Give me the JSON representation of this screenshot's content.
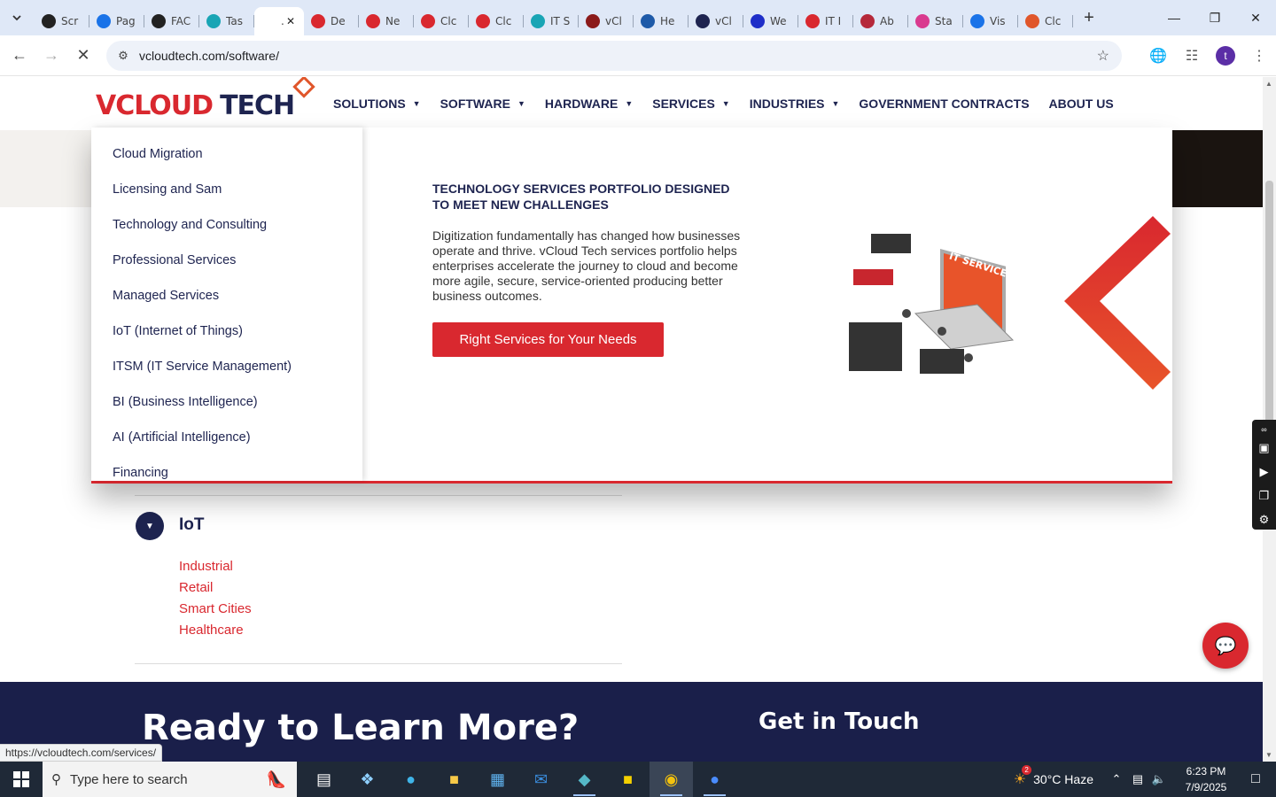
{
  "browser": {
    "tabs": [
      {
        "title": "Scr",
        "color": "#222222"
      },
      {
        "title": "Pag",
        "color": "#1a73e8"
      },
      {
        "title": "FAC",
        "color": "#222222"
      },
      {
        "title": "Tas",
        "color": "#19a5b5"
      },
      {
        "title": ".",
        "color": "#ffffff",
        "active": true
      },
      {
        "title": "De",
        "color": "#d9282f"
      },
      {
        "title": "Ne",
        "color": "#d9282f"
      },
      {
        "title": "Clc",
        "color": "#d9282f"
      },
      {
        "title": "Clc",
        "color": "#d9282f"
      },
      {
        "title": "IT S",
        "color": "#19a5b5"
      },
      {
        "title": "vCl",
        "color": "#8b1a1a"
      },
      {
        "title": "He",
        "color": "#1e5aa8"
      },
      {
        "title": "vCl",
        "color": "#1e2450"
      },
      {
        "title": "We",
        "color": "#1e2ec8"
      },
      {
        "title": "IT I",
        "color": "#d9282f"
      },
      {
        "title": "Ab",
        "color": "#b5283a"
      },
      {
        "title": "Sta",
        "color": "#d93a8f"
      },
      {
        "title": "Vis",
        "color": "#1a73e8"
      },
      {
        "title": "Clc",
        "color": "#e0562b"
      }
    ],
    "url": "vcloudtech.com/software/",
    "profile_initial": "t",
    "status_url": "https://vcloudtech.com/services/"
  },
  "site": {
    "logo": {
      "v": "V",
      "cloud": "CLOUD",
      "tech": "TECH"
    },
    "nav": [
      {
        "label": "SOLUTIONS",
        "caret": true
      },
      {
        "label": "SOFTWARE",
        "caret": true
      },
      {
        "label": "HARDWARE",
        "caret": true
      },
      {
        "label": "SERVICES",
        "caret": true
      },
      {
        "label": "INDUSTRIES",
        "caret": true
      },
      {
        "label": "GOVERNMENT CONTRACTS",
        "caret": false
      },
      {
        "label": "ABOUT US",
        "caret": false
      }
    ],
    "mega_menu": {
      "items": [
        "Cloud Migration",
        "Licensing and Sam",
        "Technology and Consulting",
        "Professional Services",
        "Managed Services",
        "IoT (Internet of Things)",
        "ITSM (IT Service Management)",
        "BI  (Business Intelligence)",
        "AI  (Artificial Intelligence)",
        "Financing"
      ],
      "heading": "TECHNOLOGY SERVICES PORTFOLIO DESIGNED TO MEET NEW CHALLENGES",
      "body": "Digitization fundamentally has changed how businesses operate and thrive. vCloud Tech services portfolio helps enterprises accelerate the journey to cloud and become more agile, secure, service-oriented producing better business outcomes.",
      "cta": "Right Services for Your Needs",
      "illustration_label": "IT SERVICE"
    },
    "accordion": {
      "title": "IoT",
      "links": [
        "Industrial",
        "Retail",
        "Smart Cities",
        "Healthcare"
      ]
    },
    "footer": {
      "heading": "Ready to Learn More?",
      "contact": "Get in Touch"
    }
  },
  "taskbar": {
    "search_placeholder": "Type here to search",
    "weather": "30°C  Haze",
    "weather_badge": "2",
    "time": "6:23 PM",
    "date": "7/9/2025"
  },
  "colors": {
    "brand_red": "#d9282f",
    "brand_navy": "#1e2450",
    "footer_bg": "#1a1f4a"
  }
}
